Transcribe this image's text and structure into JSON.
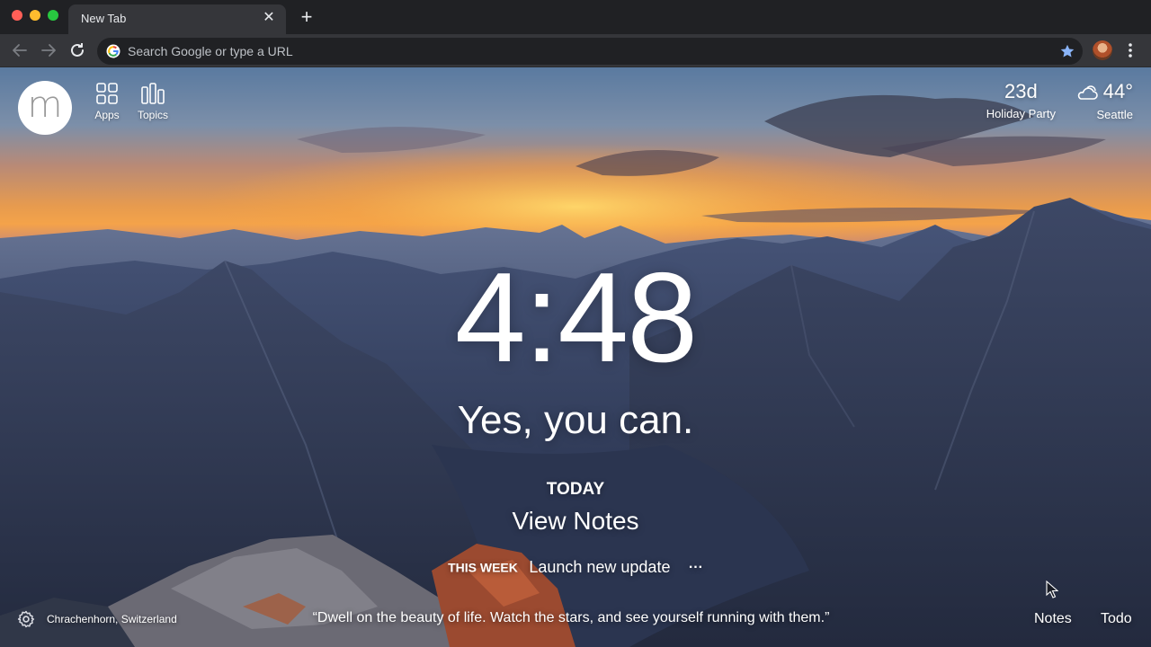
{
  "browser": {
    "tab_title": "New Tab",
    "omnibox_placeholder": "Search Google or type a URL"
  },
  "icons": {
    "back": "back-arrow-icon",
    "forward": "forward-arrow-icon",
    "reload": "reload-icon",
    "google": "google-icon",
    "bookmark": "star-icon",
    "menu": "three-dot-menu-icon",
    "apps": "grid-icon",
    "topics": "bars-icon",
    "weather": "cloud-sun-icon",
    "settings": "gear-icon"
  },
  "momentum": {
    "logo_letter": "m",
    "nav": {
      "apps_label": "Apps",
      "topics_label": "Topics"
    },
    "countdown": {
      "value": "23d",
      "label": "Holiday Party"
    },
    "weather": {
      "temp": "44°",
      "location": "Seattle"
    },
    "clock": "4:48",
    "mantra": "Yes, you can.",
    "focus": {
      "title": "TODAY",
      "value": "View Notes"
    },
    "week": {
      "label": "THIS WEEK",
      "value": "Launch new update",
      "more": "···"
    },
    "footer": {
      "location": "Chrachenhorn, Switzerland",
      "quote": "“Dwell on the beauty of life. Watch the stars, and see yourself running with them.”",
      "notes": "Notes",
      "todo": "Todo"
    }
  },
  "colors": {
    "tabstrip": "#202124",
    "toolbar": "#35363a",
    "star": "#8ab4f8"
  }
}
